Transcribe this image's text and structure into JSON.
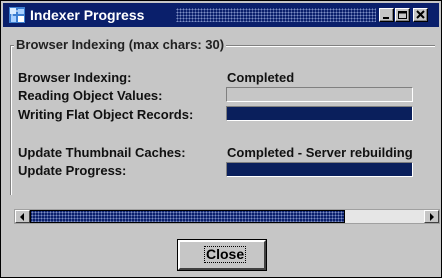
{
  "window": {
    "title": "Indexer Progress"
  },
  "group": {
    "title": "Browser Indexing (max chars: 30)"
  },
  "rows": {
    "browser_indexing": {
      "label": "Browser Indexing:",
      "value": "Completed"
    },
    "reading_object_values": {
      "label": "Reading Object Values:",
      "progress": 0.0
    },
    "writing_flat_object_records": {
      "label": "Writing Flat Object Records:",
      "progress": 1.0
    },
    "update_thumbnail_caches": {
      "label": "Update Thumbnail Caches:",
      "value": "Completed - Server rebuilding"
    },
    "update_progress": {
      "label": "Update Progress:",
      "progress": 1.0
    }
  },
  "scrollbar": {
    "position": 0.8
  },
  "buttons": {
    "close_label": "Close"
  },
  "colors": {
    "titlebar": "#0a1f6b",
    "progress_fill": "#0a1f5c",
    "face": "#c6c6c6"
  },
  "icons": {
    "app": "indexer-app-icon",
    "minimize": "minimize-icon",
    "maximize": "maximize-icon",
    "close": "close-icon",
    "scroll_left": "arrow-left-icon",
    "scroll_right": "arrow-right-icon"
  }
}
